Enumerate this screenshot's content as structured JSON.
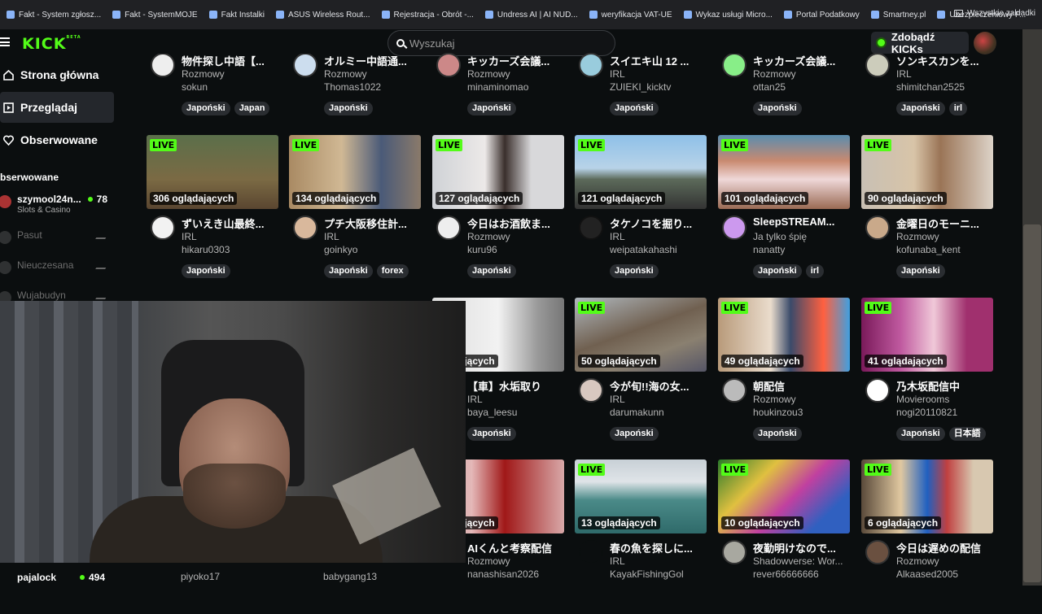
{
  "bookmarks": [
    "Fakt - System zgłosz...",
    "Fakt - SystemMOJE",
    "Fakt Instalki",
    "ASUS Wireless Rout...",
    "Rejestracja - Obrót -...",
    "Undress AI | AI NUD...",
    "weryfikacja VAT-UE",
    "Wykaz usługi Micro...",
    "Portal Podatkowy",
    "Smartney.pl",
    "Ubezpieczeniowy F..."
  ],
  "bookmarks_more": "»",
  "bookmarks_all": "Wszystkie zakładki",
  "header": {
    "logo": "KICK",
    "logo_beta": "BETA",
    "search_placeholder": "Wyszukaj",
    "kicks_button": "Zdobądź KICKs"
  },
  "nav": [
    {
      "label": "Strona główna",
      "icon": "home-icon"
    },
    {
      "label": "Przeglądaj",
      "icon": "browse-icon"
    },
    {
      "label": "Obserwowane",
      "icon": "heart-icon"
    }
  ],
  "following_title": "bserwowane",
  "following": [
    {
      "name": "szymool24n...",
      "category": "Slots & Casino",
      "viewers": "78",
      "online": true
    },
    {
      "name": "Pasut",
      "online": false
    },
    {
      "name": "Nieuczesana",
      "online": false
    },
    {
      "name": "Wujabudyn",
      "online": false
    }
  ],
  "following_bottom": {
    "name": "pajalock",
    "viewers": "494"
  },
  "top_row": [
    {
      "title": "物件探し中語【...",
      "category": "Rozmowy",
      "streamer": "sokun",
      "tags": [
        "Japoński",
        "Japan"
      ]
    },
    {
      "title": "オルミー中語通...",
      "category": "Rozmowy",
      "streamer": "Thomas1022",
      "tags": [
        "Japoński"
      ]
    },
    {
      "title": "キッカーズ会議...",
      "category": "Rozmowy",
      "streamer": "minaminomao",
      "tags": [
        "Japoński"
      ]
    },
    {
      "title": "スイエキ山 12 ...",
      "category": "IRL",
      "streamer": "ZUIEKI_kicktv",
      "tags": [
        "Japoński"
      ]
    },
    {
      "title": "キッカーズ会議...",
      "category": "Rozmowy",
      "streamer": "ottan25",
      "tags": [
        "Japoński"
      ]
    },
    {
      "title": "ソンキスカンを...",
      "category": "IRL",
      "streamer": "shimitchan2525",
      "tags": [
        "Japoński",
        "irl"
      ]
    }
  ],
  "row2": [
    {
      "viewers": "306 oglądających",
      "title": "ずいえき山最終...",
      "category": "IRL",
      "streamer": "hikaru0303",
      "tags": [
        "Japoński"
      ]
    },
    {
      "viewers": "134 oglądających",
      "title": "プチ大阪移住計...",
      "category": "IRL",
      "streamer": "goinkyo",
      "tags": [
        "Japoński",
        "forex"
      ]
    },
    {
      "viewers": "127 oglądających",
      "title": "今日はお酒飲ま...",
      "category": "Rozmowy",
      "streamer": "kuru96",
      "tags": [
        "Japoński"
      ]
    },
    {
      "viewers": "121 oglądających",
      "title": "タケノコを掘り...",
      "category": "IRL",
      "streamer": "weipatakahashi",
      "tags": [
        "Japoński"
      ]
    },
    {
      "viewers": "101 oglądających",
      "title": "SleepSTREAM...",
      "category": "Ja tylko śpię",
      "streamer": "nanatty",
      "tags": [
        "Japoński",
        "irl"
      ]
    },
    {
      "viewers": "90 oglądających",
      "title": "金曜日のモーニ...",
      "category": "Rozmowy",
      "streamer": "kofunaba_kent",
      "tags": [
        "Japoński"
      ]
    }
  ],
  "row3": [
    {
      "viewers": "glądających",
      "title": "【車】水垢取り",
      "category": "IRL",
      "streamer": "baya_leesu",
      "tags": [
        "Japoński"
      ]
    },
    {
      "viewers": "50 oglądających",
      "title": "今が旬!!海の女...",
      "category": "IRL",
      "streamer": "darumakunn",
      "tags": [
        "Japoński"
      ]
    },
    {
      "viewers": "49 oglądających",
      "title": "朝配信",
      "category": "Rozmowy",
      "streamer": "houkinzou3",
      "tags": [
        "Japoński"
      ]
    },
    {
      "viewers": "41 oglądających",
      "title": "乃木坂配信中",
      "category": "Movierooms",
      "streamer": "nogi20110821",
      "tags": [
        "Japoński",
        "日本語"
      ]
    }
  ],
  "row4": [
    {
      "viewers": "glądających",
      "title": "AIくんと考察配信",
      "category": "Rozmowy",
      "streamer": "nanashisan2026"
    },
    {
      "viewers": "13 oglądających",
      "title": "春の魚を探しに...",
      "category": "IRL",
      "streamer": "KayakFishingGol"
    },
    {
      "viewers": "10 oglądających",
      "title": "夜勤明けなので...",
      "category": "Shadowverse: Wor...",
      "streamer": "rever66666666"
    },
    {
      "viewers": "6 oglądających",
      "title": "今日は遅めの配信",
      "category": "Rozmowy",
      "streamer": "Alkaased2005"
    }
  ],
  "hidden_row_names": {
    "c1": "piyoko17",
    "c2": "babygang13"
  },
  "live_label": "LIVE",
  "colors": {
    "accent": "#53fc18",
    "bg": "#0b0e0f",
    "tag_bg": "#2a2d31"
  }
}
